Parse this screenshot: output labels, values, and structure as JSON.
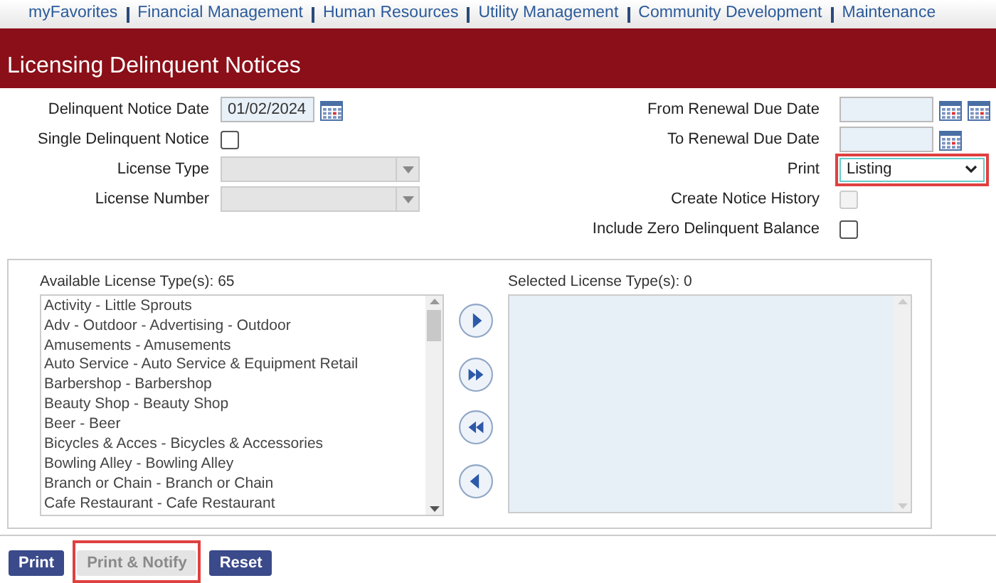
{
  "nav": [
    "myFavorites",
    "Financial Management",
    "Human Resources",
    "Utility Management",
    "Community Development",
    "Maintenance"
  ],
  "title": "Licensing Delinquent Notices",
  "left_fields": [
    {
      "kind": "date",
      "label": "Delinquent Notice Date",
      "value": "01/02/2024"
    },
    {
      "kind": "checkbox",
      "label": "Single Delinquent Notice",
      "checked": false,
      "disabled": false
    },
    {
      "kind": "select",
      "label": "License Type",
      "disabled": true
    },
    {
      "kind": "select",
      "label": "License Number",
      "disabled": true
    }
  ],
  "right_fields": [
    {
      "kind": "date2",
      "label": "From Renewal Due Date"
    },
    {
      "kind": "date",
      "label": "To Renewal Due Date"
    },
    {
      "kind": "select",
      "label": "Print",
      "value": "Listing",
      "highlighted": true
    },
    {
      "kind": "checkbox",
      "label": "Create Notice History",
      "checked": false,
      "disabled": true
    },
    {
      "kind": "checkbox",
      "label": "Include Zero Delinquent Balance",
      "checked": false,
      "disabled": false
    }
  ],
  "available": {
    "label": "Available License Type(s): 65",
    "items": [
      "Activity - Little Sprouts",
      "Adv - Outdoor - Advertising - Outdoor",
      "Amusements - Amusements",
      "Auto Service - Auto Service & Equipment Retail",
      "Barbershop - Barbershop",
      "Beauty Shop - Beauty Shop",
      "Beer - Beer",
      "Bicycles & Acces - Bicycles & Accessories",
      "Bowling Alley - Bowling Alley",
      "Branch or Chain - Branch or Chain",
      "Cafe Restaurant - Cafe Restaurant"
    ]
  },
  "selected": {
    "label": "Selected License Type(s): 0"
  },
  "buttons": [
    {
      "label": "Print",
      "disabled": false,
      "highlighted": false
    },
    {
      "label": "Print & Notify",
      "disabled": true,
      "highlighted": true
    },
    {
      "label": "Reset",
      "disabled": false,
      "highlighted": false
    }
  ]
}
